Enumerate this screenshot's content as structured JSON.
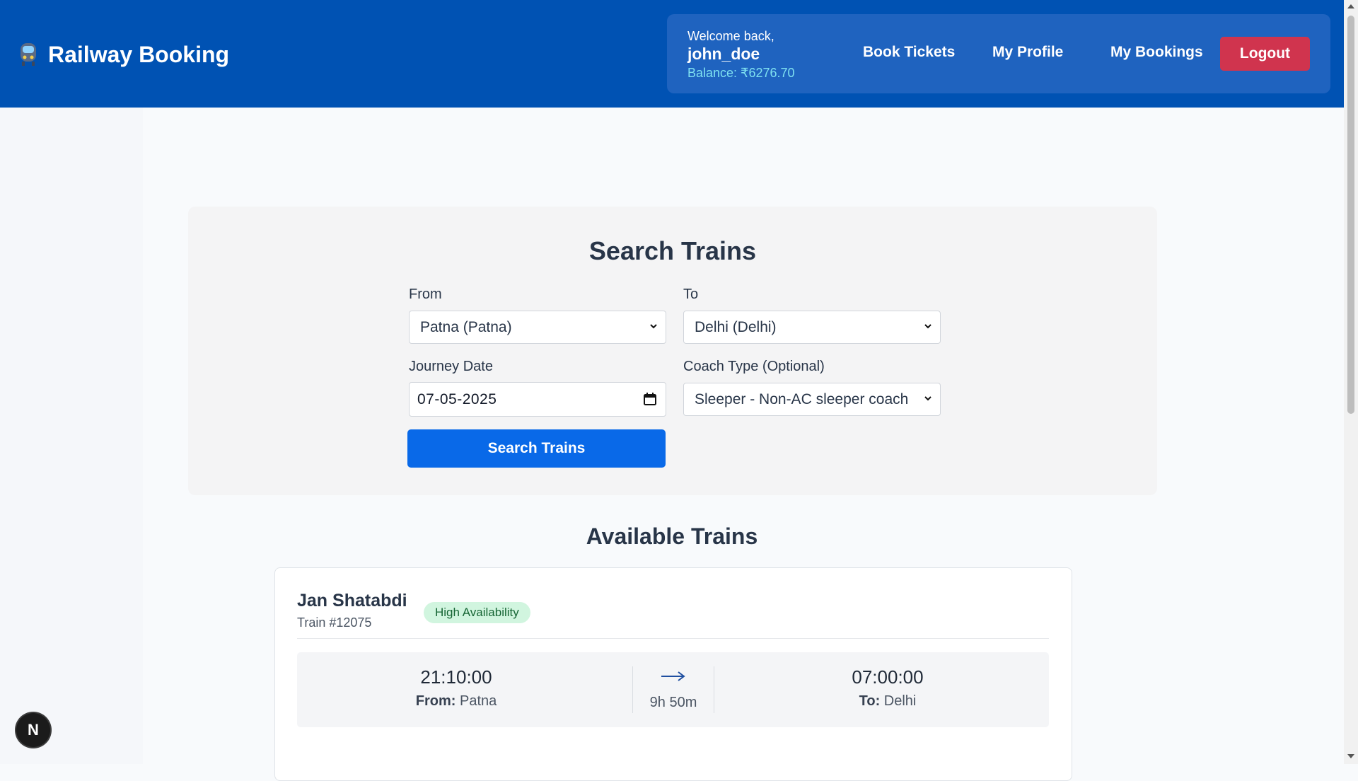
{
  "header": {
    "brand_icon": "train-emoji-icon",
    "brand_title": "Railway Booking",
    "welcome_text": "Welcome back,",
    "username": "john_doe",
    "balance": "Balance: ₹6276.70",
    "nav": {
      "book_tickets": "Book Tickets",
      "my_profile": "My Profile",
      "my_bookings": "My Bookings",
      "logout": "Logout"
    }
  },
  "search": {
    "title": "Search Trains",
    "from_label": "From",
    "from_value": "Patna (Patna)",
    "to_label": "To",
    "to_value": "Delhi (Delhi)",
    "date_label": "Journey Date",
    "date_value": "07-05-2025",
    "coach_label": "Coach Type (Optional)",
    "coach_value": "Sleeper - Non-AC sleeper coach",
    "button_label": "Search Trains"
  },
  "results": {
    "title": "Available Trains",
    "trains": [
      {
        "name": "Jan Shatabdi",
        "number": "Train #12075",
        "availability": "High Availability",
        "departure_time": "21:10:00",
        "from_label": "From:",
        "from_station": "Patna",
        "duration": "9h 50m",
        "arrival_time": "07:00:00",
        "to_label": "To:",
        "to_station": "Delhi"
      }
    ]
  },
  "floating_button": {
    "label": "N"
  },
  "colors": {
    "header_bg": "#0052b3",
    "nav_box_bg": "#1f63bf",
    "logout_bg": "#d0344e",
    "primary_button": "#0969e8",
    "badge_bg": "#d1f5df",
    "badge_text": "#166534",
    "balance_text": "#7ee0f0"
  }
}
